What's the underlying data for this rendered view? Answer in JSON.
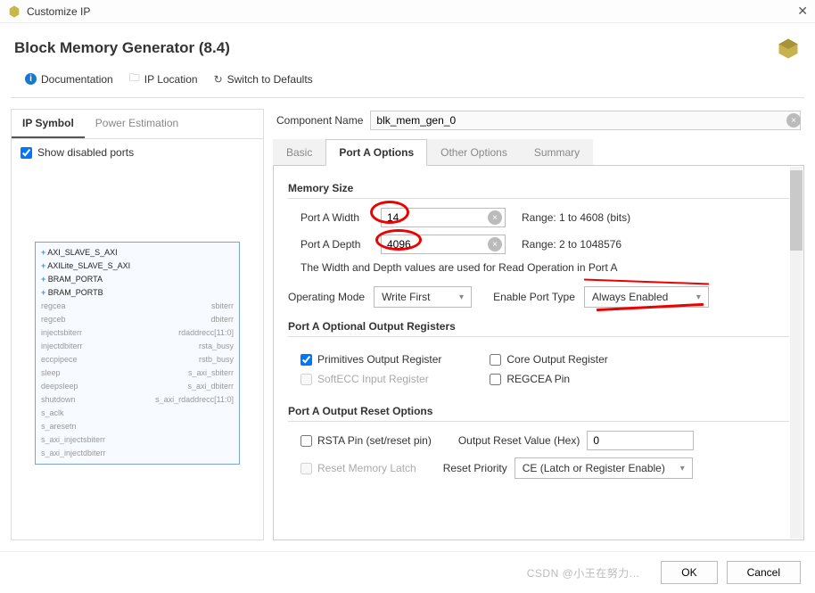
{
  "titlebar": {
    "title": "Customize IP"
  },
  "header": {
    "title": "Block Memory Generator (8.4)"
  },
  "toolbar": {
    "documentation": "Documentation",
    "ip_location": "IP Location",
    "switch_defaults": "Switch to Defaults"
  },
  "left": {
    "tabs": {
      "ip_symbol": "IP Symbol",
      "power_est": "Power Estimation"
    },
    "show_ports": "Show disabled ports",
    "ports_left": [
      "AXI_SLAVE_S_AXI",
      "AXILite_SLAVE_S_AXI",
      "BRAM_PORTA",
      "BRAM_PORTB",
      "regcea",
      "regceb",
      "injectsbiterr",
      "injectdbiterr",
      "eccpipece",
      "sleep",
      "deepsleep",
      "shutdown",
      "s_aclk",
      "s_aresetn",
      "s_axi_injectsbiterr",
      "s_axi_injectdbiterr"
    ],
    "ports_right": [
      "sbiterr",
      "dbiterr",
      "rdaddrecc[11:0]",
      "rsta_busy",
      "rstb_busy",
      "s_axi_sbiterr",
      "s_axi_dbiterr",
      "s_axi_rdaddrecc[11:0]"
    ]
  },
  "component": {
    "label": "Component Name",
    "value": "blk_mem_gen_0"
  },
  "tabs": {
    "basic": "Basic",
    "porta": "Port A Options",
    "other": "Other Options",
    "summary": "Summary"
  },
  "memsize": {
    "heading": "Memory Size",
    "width_label": "Port A Width",
    "width_value": "14",
    "width_range": "Range: 1 to 4608 (bits)",
    "depth_label": "Port A Depth",
    "depth_value": "4096",
    "depth_range": "Range: 2 to 1048576",
    "note": "The Width and Depth values are used for Read Operation in Port A"
  },
  "mode": {
    "op_label": "Operating Mode",
    "op_value": "Write First",
    "enable_label": "Enable Port Type",
    "enable_value": "Always Enabled"
  },
  "outreg": {
    "heading": "Port A Optional Output Registers",
    "primitives": "Primitives Output Register",
    "core": "Core Output Register",
    "softecc": "SoftECC Input Register",
    "regcea": "REGCEA Pin"
  },
  "reset": {
    "heading": "Port A Output Reset Options",
    "rsta": "RSTA Pin (set/reset pin)",
    "outval_label": "Output Reset Value (Hex)",
    "outval_value": "0",
    "latch": "Reset Memory Latch",
    "priority_label": "Reset Priority",
    "priority_value": "CE (Latch or Register Enable)"
  },
  "footer": {
    "ok": "OK",
    "cancel": "Cancel",
    "watermark": "CSDN @小王在努力..."
  }
}
